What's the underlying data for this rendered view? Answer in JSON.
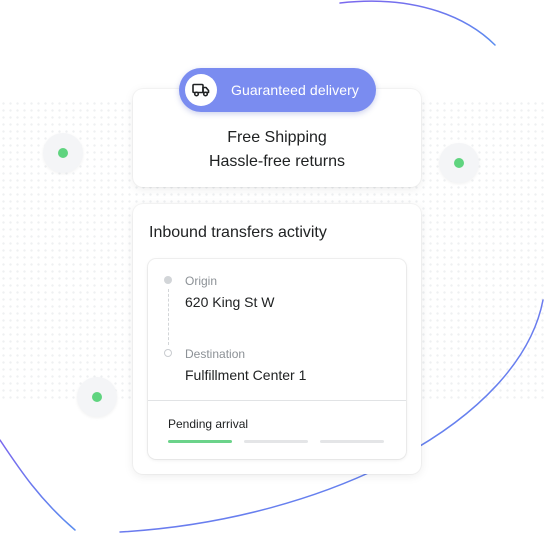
{
  "badge": {
    "label": "Guaranteed delivery",
    "icon": "truck-icon",
    "color": "#7a8cf0"
  },
  "perks": {
    "line1": "Free Shipping",
    "line2": "Hassle-free returns"
  },
  "activity": {
    "title": "Inbound transfers activity",
    "origin_label": "Origin",
    "origin_value": "620 King St W",
    "destination_label": "Destination",
    "destination_value": "Fulfillment Center 1",
    "status": "Pending arrival",
    "progress": {
      "completed_steps": 1,
      "total_steps": 3
    }
  },
  "colors": {
    "accent": "#7a8cf0",
    "success": "#5fd47f",
    "arc": "#8a7ef0"
  }
}
